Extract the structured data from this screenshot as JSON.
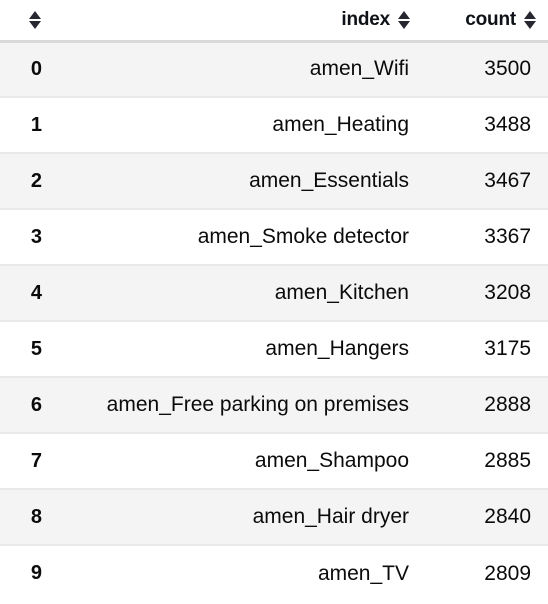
{
  "table": {
    "columns": [
      {
        "key": "rowindex",
        "label": "",
        "sort_icon": "sort-updown-icon",
        "align": "right"
      },
      {
        "key": "index",
        "label": "index",
        "sort_icon": "sort-updown-icon",
        "align": "right"
      },
      {
        "key": "count",
        "label": "count",
        "sort_icon": "sort-updown-icon",
        "align": "right"
      }
    ],
    "rows": [
      {
        "rowindex": "0",
        "index": "amen_Wifi",
        "count": "3500"
      },
      {
        "rowindex": "1",
        "index": "amen_Heating",
        "count": "3488"
      },
      {
        "rowindex": "2",
        "index": "amen_Essentials",
        "count": "3467"
      },
      {
        "rowindex": "3",
        "index": "amen_Smoke detector",
        "count": "3367"
      },
      {
        "rowindex": "4",
        "index": "amen_Kitchen",
        "count": "3208"
      },
      {
        "rowindex": "5",
        "index": "amen_Hangers",
        "count": "3175"
      },
      {
        "rowindex": "6",
        "index": "amen_Free parking on premises",
        "count": "2888"
      },
      {
        "rowindex": "7",
        "index": "amen_Shampoo",
        "count": "2885"
      },
      {
        "rowindex": "8",
        "index": "amen_Hair dryer",
        "count": "2840"
      },
      {
        "rowindex": "9",
        "index": "amen_TV",
        "count": "2809"
      }
    ]
  },
  "colors": {
    "row_stripe": "#f4f4f4",
    "row_plain": "#ffffff",
    "header_rule": "#d9d9d9",
    "row_rule": "#e9e9e9",
    "text": "#0b0b0b",
    "icon": "#262730"
  }
}
